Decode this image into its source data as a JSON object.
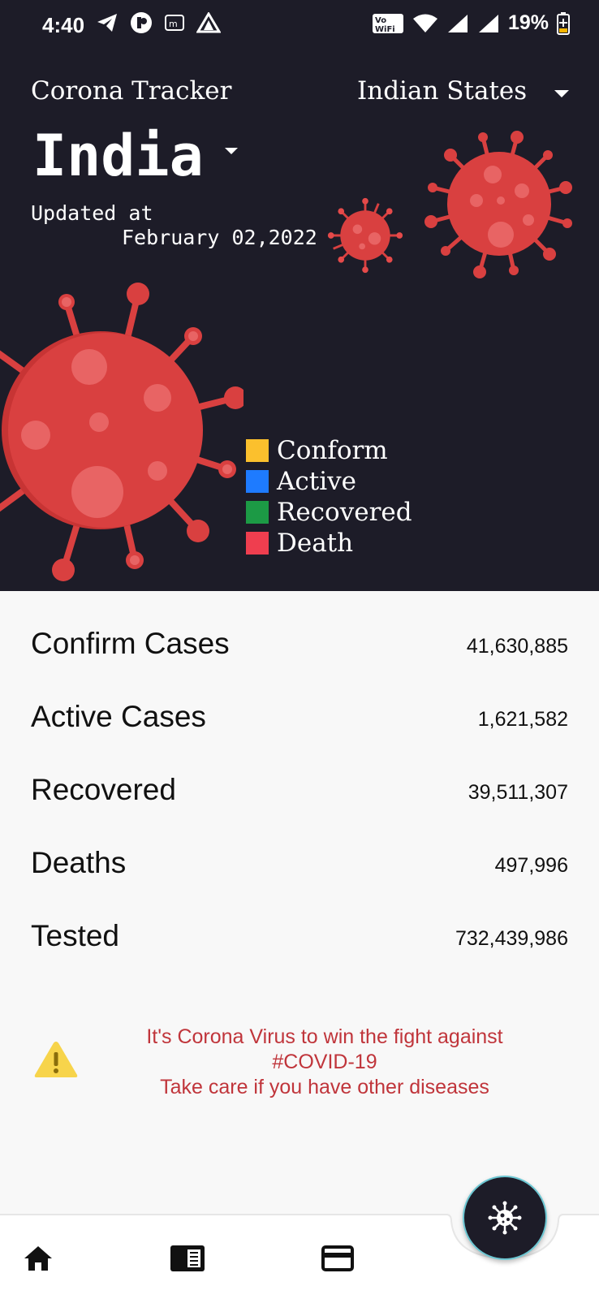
{
  "status_bar": {
    "time": "4:40",
    "battery": "19%"
  },
  "header": {
    "app_title": "Corona Tracker",
    "region_selector": "Indian States",
    "country": "India",
    "updated_label": "Updated at",
    "updated_date": "February 02,2022"
  },
  "legend": [
    {
      "label": "Conform",
      "color": "#fbc02d"
    },
    {
      "label": "Active",
      "color": "#1e7bff"
    },
    {
      "label": "Recovered",
      "color": "#1c9a45"
    },
    {
      "label": "Death",
      "color": "#ef3e4f"
    }
  ],
  "stats": [
    {
      "label": "Confirm Cases",
      "value": "41,630,885"
    },
    {
      "label": "Active Cases",
      "value": "1,621,582"
    },
    {
      "label": "Recovered",
      "value": "39,511,307"
    },
    {
      "label": "Deaths",
      "value": "497,996"
    },
    {
      "label": "Tested",
      "value": "732,439,986"
    }
  ],
  "warning": {
    "line1": "It's Corona Virus to win the fight against",
    "line2": "#COVID-19",
    "line3": "Take care if you have other diseases"
  },
  "nav": {
    "items": [
      {
        "icon": "home-icon"
      },
      {
        "icon": "news-icon"
      },
      {
        "icon": "card-icon"
      }
    ],
    "fab_icon": "virus-icon"
  },
  "colors": {
    "header_bg": "#1d1c28",
    "virus": "#d94040",
    "warning_text": "#c0353b",
    "fab_border": "#6cc7d3"
  }
}
